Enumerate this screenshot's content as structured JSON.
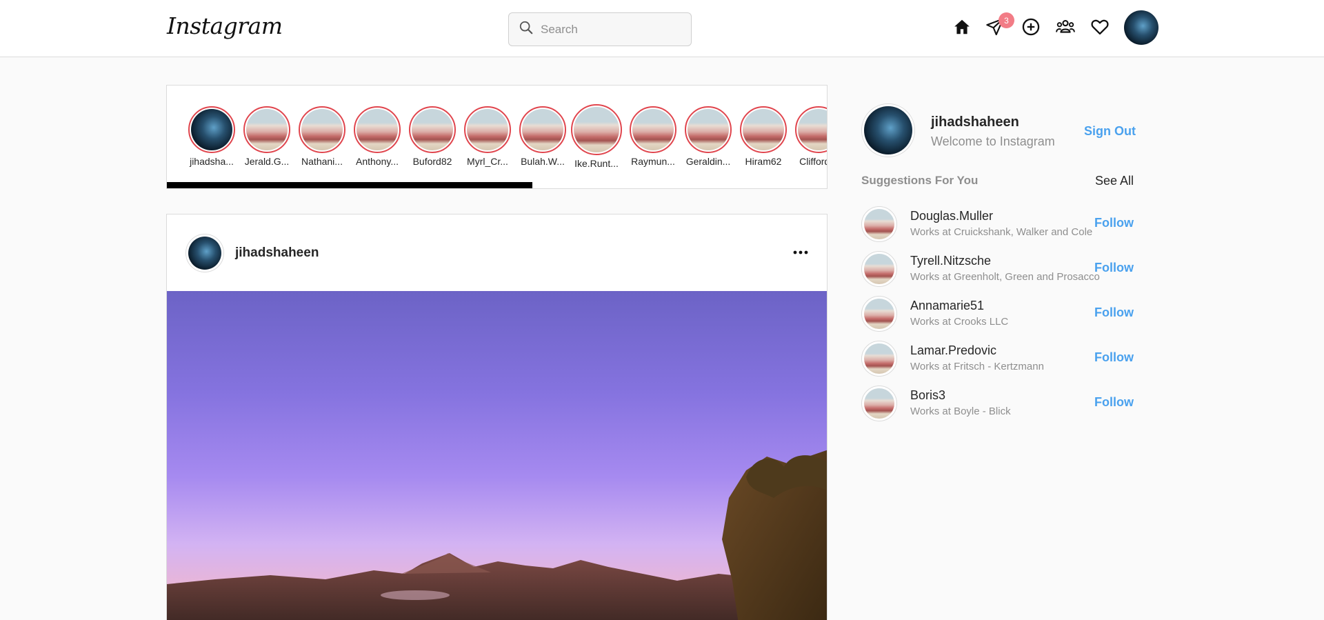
{
  "header": {
    "logo": "Instagram",
    "search_placeholder": "Search",
    "messages_badge": "3",
    "icons": [
      "home-icon",
      "direct-message-icon",
      "new-post-icon",
      "people-icon",
      "activity-heart-icon",
      "profile-avatar"
    ]
  },
  "stories": [
    {
      "name": "jihadsha...",
      "avatar": "space"
    },
    {
      "name": "Jerald.G...",
      "avatar": "beach"
    },
    {
      "name": "Nathani...",
      "avatar": "beach"
    },
    {
      "name": "Anthony...",
      "avatar": "beach"
    },
    {
      "name": "Buford82",
      "avatar": "beach"
    },
    {
      "name": "Myrl_Cr...",
      "avatar": "beach"
    },
    {
      "name": "Bulah.W...",
      "avatar": "beach"
    },
    {
      "name": "Ike.Runt...",
      "avatar": "beach"
    },
    {
      "name": "Raymun...",
      "avatar": "beach"
    },
    {
      "name": "Geraldin...",
      "avatar": "beach"
    },
    {
      "name": "Hiram62",
      "avatar": "beach"
    },
    {
      "name": "Clifford...",
      "avatar": "beach"
    }
  ],
  "post": {
    "username": "jihadshaheen",
    "more_icon": "more-horizontal-icon"
  },
  "sidebar": {
    "username": "jihadshaheen",
    "subtitle": "Welcome to Instagram",
    "sign_out": "Sign Out",
    "suggestions_title": "Suggestions For You",
    "see_all": "See All",
    "suggestions": [
      {
        "username": "Douglas.Muller",
        "work": "Works at Cruickshank, Walker and Cole",
        "action": "Follow"
      },
      {
        "username": "Tyrell.Nitzsche",
        "work": "Works at Greenholt, Green and Prosacco",
        "action": "Follow"
      },
      {
        "username": "Annamarie51",
        "work": "Works at Crooks LLC",
        "action": "Follow"
      },
      {
        "username": "Lamar.Predovic",
        "work": "Works at Fritsch - Kertzmann",
        "action": "Follow"
      },
      {
        "username": "Boris3",
        "work": "Works at Boyle - Blick",
        "action": "Follow"
      }
    ]
  },
  "colors": {
    "link_blue": "#4aa1ee",
    "story_ring": "#e0454d",
    "badge": "#f27c86"
  }
}
